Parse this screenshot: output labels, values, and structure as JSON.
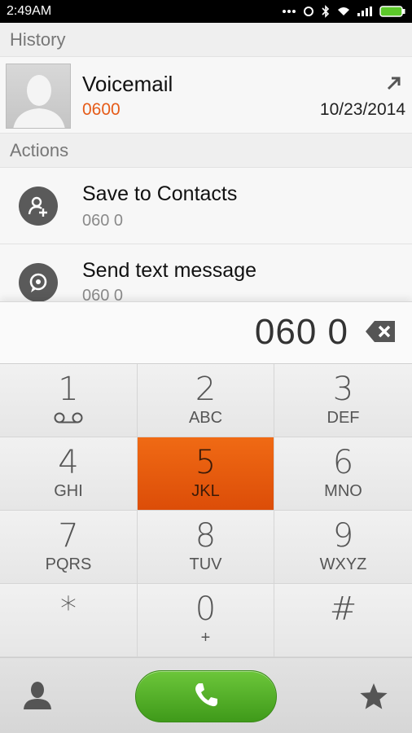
{
  "status_bar": {
    "time": "2:49AM"
  },
  "history": {
    "header": "History",
    "entry": {
      "name": "Voicemail",
      "number": "0600",
      "date": "10/23/2014",
      "call_type_icon": "outgoing-call-arrow-icon"
    }
  },
  "actions": {
    "header": "Actions",
    "items": [
      {
        "title": "Save to Contacts",
        "subtitle": "060 0",
        "icon": "add-contact-icon"
      },
      {
        "title": "Send text message",
        "subtitle": "060 0",
        "icon": "message-icon"
      }
    ]
  },
  "dialer": {
    "number": "060 0",
    "keys": [
      {
        "digit": "1",
        "letters": ""
      },
      {
        "digit": "2",
        "letters": "ABC"
      },
      {
        "digit": "3",
        "letters": "DEF"
      },
      {
        "digit": "4",
        "letters": "GHI"
      },
      {
        "digit": "5",
        "letters": "JKL"
      },
      {
        "digit": "6",
        "letters": "MNO"
      },
      {
        "digit": "7",
        "letters": "PQRS"
      },
      {
        "digit": "8",
        "letters": "TUV"
      },
      {
        "digit": "9",
        "letters": "WXYZ"
      },
      {
        "digit": "*",
        "letters": ""
      },
      {
        "digit": "0",
        "letters": "+"
      },
      {
        "digit": "#",
        "letters": ""
      }
    ],
    "pressed_key": "5"
  },
  "colors": {
    "accent": "#e55b18",
    "call_button": "#4caf28",
    "pressed_key": "#e8590d"
  }
}
